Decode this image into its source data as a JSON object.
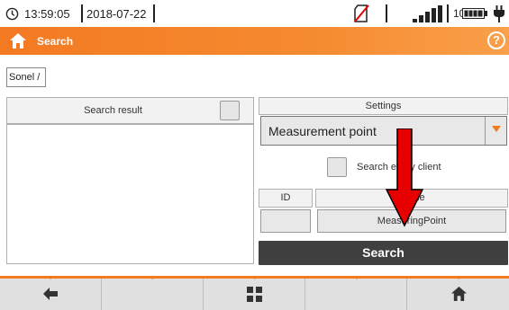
{
  "status": {
    "time": "13:59:05",
    "date": "2018-07-22",
    "battery_percent": "100 %"
  },
  "header": {
    "title": "Search",
    "help": "?"
  },
  "breadcrumb": {
    "path": "Sonel /"
  },
  "results": {
    "label": "Search result",
    "select_all_checked": false,
    "items": []
  },
  "settings": {
    "label": "Settings",
    "type_value": "Measurement point",
    "search_every_client_label": "Search every client",
    "search_every_client_checked": false,
    "id_label": "ID",
    "name_label": "Name",
    "id_value": "",
    "name_value": "MeasuringPoint",
    "search_button": "Search"
  },
  "footer": {
    "buttons": [
      "back-icon",
      "",
      "grid-icon",
      "",
      "home-icon"
    ]
  },
  "colors": {
    "accent": "#f47a22",
    "search_button": "#404040",
    "annotation_arrow": "#e60000"
  }
}
